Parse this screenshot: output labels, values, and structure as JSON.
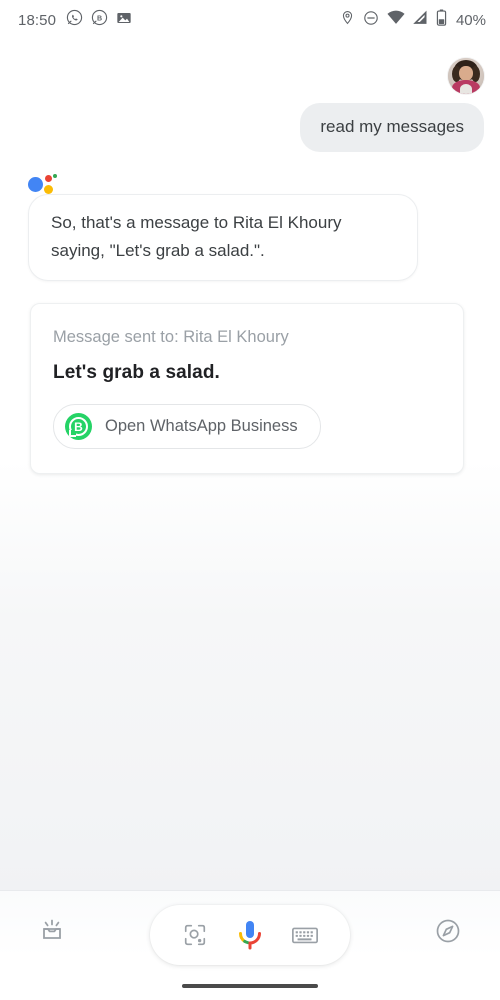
{
  "status_bar": {
    "time": "18:50",
    "battery_percent": "40%",
    "left_icons": [
      "whatsapp-icon",
      "whatsapp-business-icon",
      "image-icon"
    ],
    "right_icons": [
      "location-icon",
      "do-not-disturb-icon",
      "wifi-icon",
      "cell-signal-icon",
      "battery-icon"
    ]
  },
  "conversation": {
    "user_message": {
      "text": "read my messages",
      "avatar": "user-avatar"
    },
    "assistant_logo": "google-assistant-logo",
    "assistant_message": {
      "text": "So, that's a message to Rita El Khoury saying, \"Let's grab a salad.\"."
    },
    "result_card": {
      "label": "Message sent to: Rita El Khoury",
      "message": "Let's grab a salad.",
      "action_label": "Open WhatsApp Business",
      "action_icon": "whatsapp-business-icon",
      "action_icon_letter": "B"
    }
  },
  "bottom_bar": {
    "snapshot_icon": "snapshot-inbox-icon",
    "lens_icon": "google-lens-icon",
    "mic_icon": "google-mic-icon",
    "keyboard_icon": "keyboard-icon",
    "explore_icon": "compass-explore-icon"
  },
  "colors": {
    "google_blue": "#4285f4",
    "google_red": "#ea4335",
    "google_yellow": "#fbbc05",
    "google_green": "#34a853",
    "whatsapp_green": "#25d366",
    "bubble_gray": "#eceef0",
    "text_primary": "#202124",
    "text_secondary": "#5f6368",
    "text_muted": "#9aa0a6"
  }
}
